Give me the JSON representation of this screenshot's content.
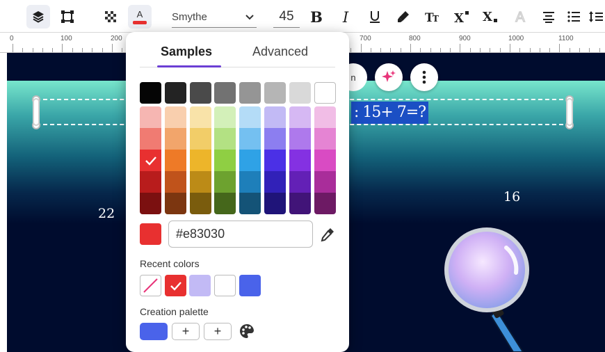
{
  "toolbar": {
    "font_name": "Smythe",
    "font_size": "45"
  },
  "ruler": {
    "labels": [
      "0",
      "100",
      "200",
      "700",
      "800",
      "900",
      "1000",
      "1100"
    ]
  },
  "canvas": {
    "selected_text": ": 15+ 7=?",
    "label_left": "22",
    "label_right": "16",
    "pill_text": "n"
  },
  "color_picker": {
    "tab_samples": "Samples",
    "tab_advanced": "Advanced",
    "grays": [
      "#050505",
      "#232323",
      "#4a4a4a",
      "#727272",
      "#959595",
      "#b5b5b5",
      "#d9d9d9",
      "#ffffff"
    ],
    "columns": [
      [
        "#f6b6b2",
        "#f07b72",
        "#e83030",
        "#b81c1c",
        "#7b1010"
      ],
      [
        "#f9cfae",
        "#f2a56b",
        "#ee7a27",
        "#c0531b",
        "#7c3610"
      ],
      [
        "#f9e3a9",
        "#f2cd68",
        "#edb52a",
        "#bc8b17",
        "#7a5c0d"
      ],
      [
        "#d3f0b9",
        "#b3e183",
        "#8fcf43",
        "#6da22f",
        "#45671b"
      ],
      [
        "#b4dcf7",
        "#74c0f1",
        "#2fa2e6",
        "#1e7fba",
        "#145377"
      ],
      [
        "#c2baf5",
        "#8c7ef0",
        "#4b30e6",
        "#3121b8",
        "#1f1479"
      ],
      [
        "#d6b8f3",
        "#ae79ec",
        "#8431e2",
        "#6320b6",
        "#411478"
      ],
      [
        "#f1bde6",
        "#e584d3",
        "#d94bc3",
        "#a92d9a",
        "#6d1a64"
      ]
    ],
    "selected_swatch": "#e83030",
    "hex_value": "#e83030",
    "recent_colors_label": "Recent colors",
    "recent_colors": [
      "none",
      "#e83030",
      "#c2baf5",
      "#ffffff",
      "#4a63ea"
    ],
    "creation_palette_label": "Creation palette",
    "palette_color": "#4a63ea",
    "add_symbol": "+"
  }
}
